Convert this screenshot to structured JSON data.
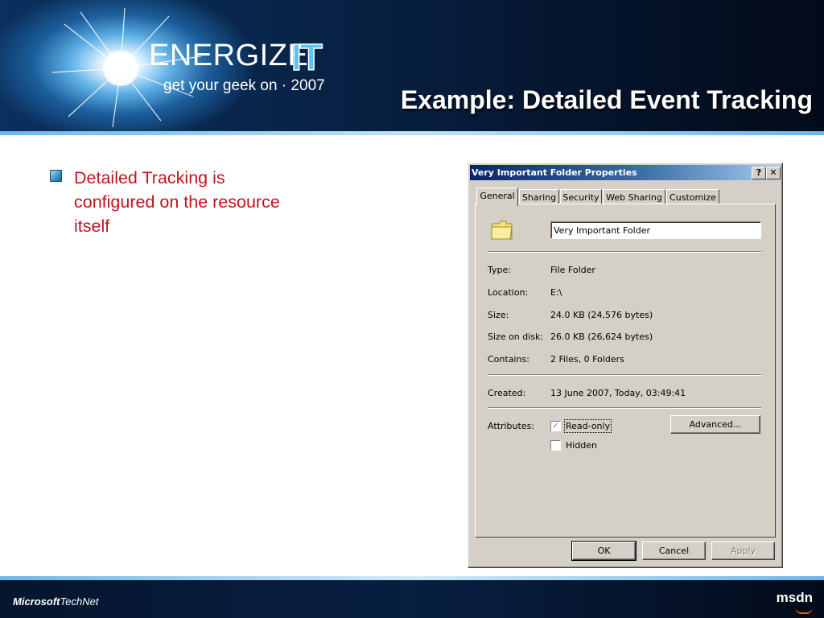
{
  "header": {
    "logo_word": "ENERGIZE",
    "logo_it": "IT",
    "tagline": "get your geek on · 2007",
    "slide_title": "Example: Detailed Event Tracking"
  },
  "bullets": [
    {
      "text": "Detailed Tracking is configured on the resource itself"
    }
  ],
  "dialog": {
    "title": "Very Important Folder Properties",
    "help_button": "?",
    "close_button": "✕",
    "tabs": [
      {
        "label": "General",
        "active": true
      },
      {
        "label": "Sharing",
        "active": false
      },
      {
        "label": "Security",
        "active": false
      },
      {
        "label": "Web Sharing",
        "active": false
      },
      {
        "label": "Customize",
        "active": false
      }
    ],
    "folder_icon": "folder-icon",
    "name_value": "Very Important Folder",
    "type_label": "Type:",
    "type_value": "File Folder",
    "location_label": "Location:",
    "location_value": "E:\\",
    "size_label": "Size:",
    "size_value": "24.0 KB (24,576 bytes)",
    "size_on_disk_label": "Size on disk:",
    "size_on_disk_value": "26.0 KB (26,624 bytes)",
    "contains_label": "Contains:",
    "contains_value": "2 Files, 0 Folders",
    "created_label": "Created:",
    "created_value": "13 June 2007, Today, 03:49:41",
    "attributes_label": "Attributes:",
    "readonly_label": "Read-only",
    "readonly_checked": true,
    "hidden_label": "Hidden",
    "hidden_checked": false,
    "advanced_button": "Advanced...",
    "ok_button": "OK",
    "cancel_button": "Cancel",
    "apply_button": "Apply"
  },
  "footer": {
    "left_brand_bold": "Microsoft",
    "left_brand": "TechNet",
    "right_brand": "msdn"
  }
}
